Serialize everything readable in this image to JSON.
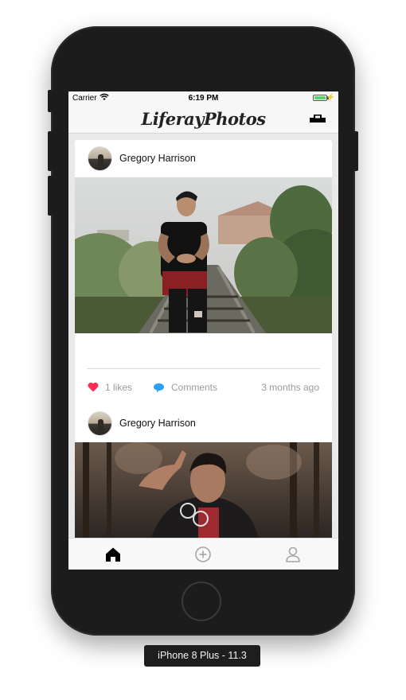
{
  "status_bar": {
    "carrier": "Carrier",
    "time": "6:19 PM"
  },
  "app": {
    "title": "LiferayPhotos"
  },
  "posts": [
    {
      "author": "Gregory Harrison",
      "likes": "1 likes",
      "comments": "Comments",
      "timestamp": "3 months ago"
    },
    {
      "author": "Gregory Harrison"
    }
  ],
  "tab_bar": {
    "items": [
      "home-icon",
      "add-circle-icon",
      "profile-icon"
    ],
    "active": "home-icon"
  },
  "device": {
    "label": "iPhone 8 Plus - 11.3"
  },
  "colors": {
    "like_heart": "#ff2d55",
    "comment_bubble": "#2d9ff0",
    "battery": "#4cd964"
  }
}
